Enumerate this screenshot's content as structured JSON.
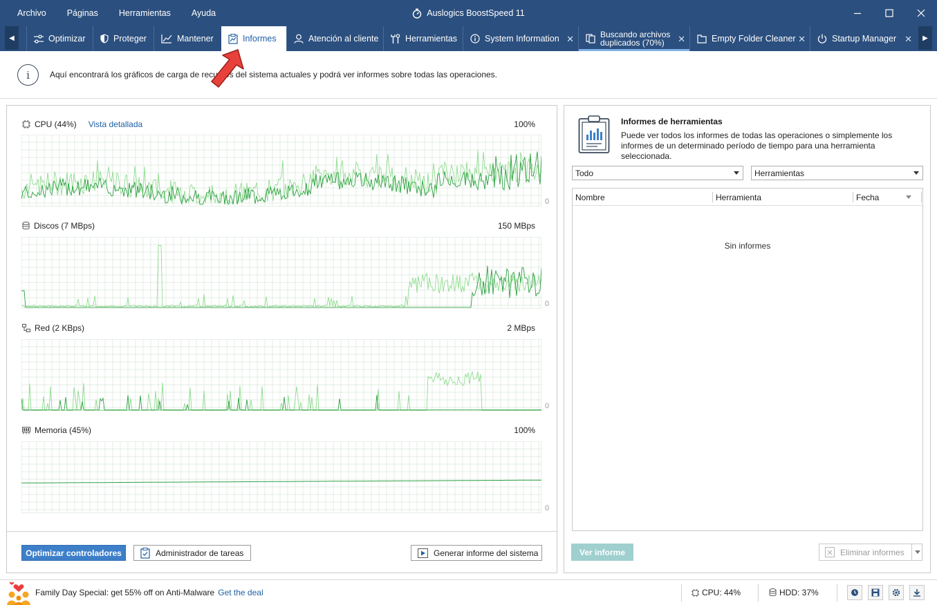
{
  "window": {
    "title": "Auslogics BoostSpeed 11",
    "menu": [
      "Archivo",
      "Páginas",
      "Herramientas",
      "Ayuda"
    ]
  },
  "tabs": [
    {
      "label": "Optimizar",
      "icon": "sliders-icon"
    },
    {
      "label": "Proteger",
      "icon": "shield-icon"
    },
    {
      "label": "Mantener",
      "icon": "chart-line-icon"
    },
    {
      "label": "Informes",
      "icon": "report-icon",
      "active": true
    },
    {
      "label": "Atención al cliente",
      "icon": "person-icon"
    },
    {
      "label": "Herramientas",
      "icon": "tools-icon"
    },
    {
      "label": "System Information",
      "icon": "info-circle-icon",
      "closable": true
    },
    {
      "label_line1": "Buscando archivos",
      "label_line2": "duplicados (70%)",
      "icon": "duplicate-files-icon",
      "closable": true,
      "progress": 0.7
    },
    {
      "label": "Empty Folder Cleaner",
      "icon": "folder-icon",
      "closable": true
    },
    {
      "label": "Startup Manager",
      "icon": "power-icon",
      "closable": true
    }
  ],
  "info": {
    "text": "Aquí encontrará los gráficos de carga de recursos del sistema actuales y podrá ver informes sobre todas las operaciones."
  },
  "graphs": {
    "cpu": {
      "title": "CPU (44%)",
      "link": "Vista detallada",
      "max": "100%",
      "zero": "0"
    },
    "disk": {
      "title": "Discos (7 MBps)",
      "max": "150 MBps",
      "zero": "0"
    },
    "net": {
      "title": "Red (2 KBps)",
      "max": "2 MBps",
      "zero": "0"
    },
    "mem": {
      "title": "Memoria (45%)",
      "max": "100%",
      "zero": "0"
    }
  },
  "left_buttons": {
    "optimize_drivers": "Optimizar controladores",
    "task_manager": "Administrador de tareas",
    "generate_report": "Generar informe del sistema"
  },
  "reports": {
    "title": "Informes de herramientas",
    "description": "Puede ver todos los informes de todas las operaciones o simplemente los informes de un determinado período de tiempo para una herramienta seleccionada.",
    "filter_period": "Todo",
    "filter_tool": "Herramientas",
    "columns": [
      "Nombre",
      "Herramienta",
      "Fecha"
    ],
    "empty": "Sin informes",
    "view_button": "Ver informe",
    "delete_button": "Eliminar informes"
  },
  "statusbar": {
    "promo_text": "Family Day Special: get 55% off on Anti-Malware",
    "promo_link": "Get the deal",
    "cpu": "CPU:  44%",
    "hdd": "HDD:  37%"
  },
  "colors": {
    "titlebar": "#2b4f7e",
    "accent": "#1e5fa5",
    "graph_line": "#2ea043",
    "graph_light": "#8fdc8f",
    "grid": "#d9e6d9"
  }
}
